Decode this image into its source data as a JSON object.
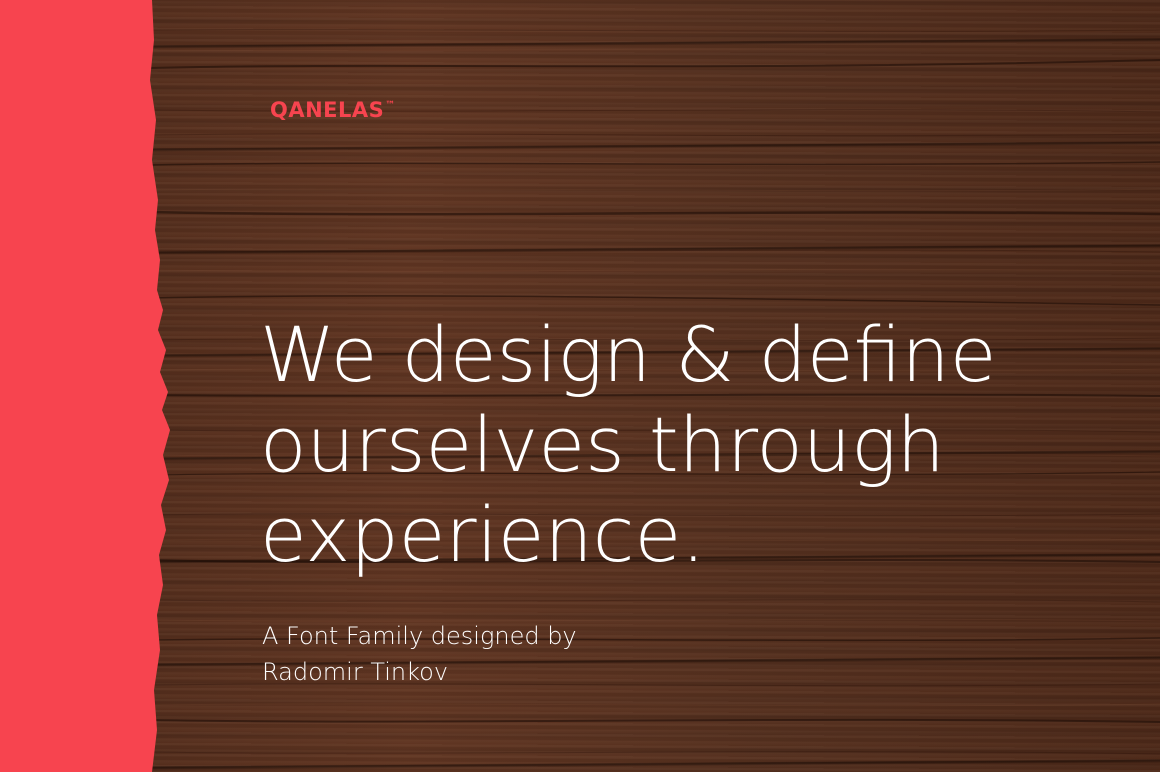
{
  "brand": {
    "name": "QANELAS",
    "trademark": "™",
    "accent_color": "#f7444f"
  },
  "headline": {
    "lines": [
      "We design & define",
      "ourselves through",
      "experience."
    ]
  },
  "subtitle": {
    "lines": [
      "A Font Family designed by",
      "Radomir Tinkov"
    ]
  },
  "background": {
    "texture": "dark-wood-planks",
    "wood_color": "#5a3220",
    "strip_color": "#f7444f"
  }
}
